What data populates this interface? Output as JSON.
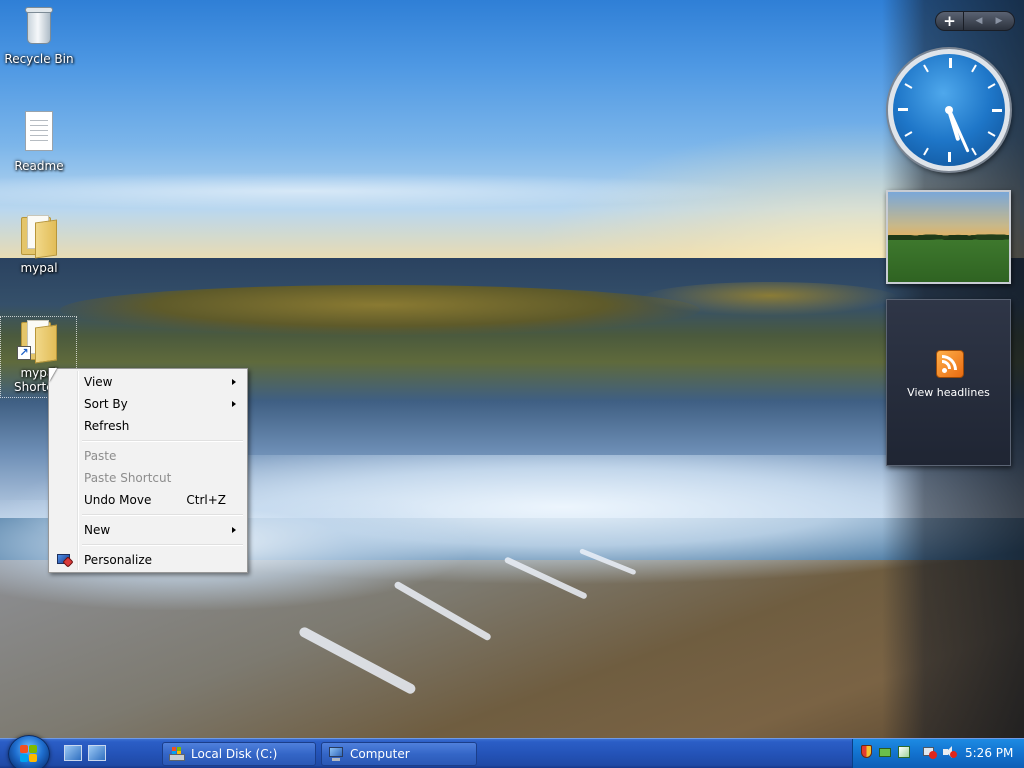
{
  "desktop": {
    "icons": [
      {
        "label": "Recycle Bin"
      },
      {
        "label": "Readme"
      },
      {
        "label": "mypal"
      },
      {
        "label": "mypal Shortcut"
      }
    ]
  },
  "context_menu": {
    "items": [
      {
        "label": "View",
        "submenu": true
      },
      {
        "label": "Sort By",
        "submenu": true
      },
      {
        "label": "Refresh"
      },
      {
        "label": "Paste",
        "disabled": true
      },
      {
        "label": "Paste Shortcut",
        "disabled": true
      },
      {
        "label": "Undo Move",
        "shortcut": "Ctrl+Z"
      },
      {
        "label": "New",
        "submenu": true
      },
      {
        "label": "Personalize",
        "icon": "personalize-icon"
      }
    ]
  },
  "sidebar": {
    "toolbar": {
      "add": "+",
      "prev": "◀",
      "next": "▶"
    },
    "clock": {
      "hour": 5,
      "minute": 26
    },
    "feeds": {
      "label": "View headlines",
      "icon": "rss-feed-icon"
    }
  },
  "taskbar": {
    "buttons": [
      {
        "label": "Local Disk (C:)",
        "icon": "drive-icon"
      },
      {
        "label": "Computer",
        "icon": "computer-icon"
      }
    ],
    "tray": {
      "time": "5:26 PM",
      "icons": [
        "security-shield-icon",
        "network-icon",
        "windows-update-icon",
        "network-status-icon",
        "volume-muted-icon"
      ]
    }
  },
  "colors": {
    "taskbar": "#2453b8",
    "tray": "#1272cf",
    "menu_background": "#f2f2f2"
  }
}
